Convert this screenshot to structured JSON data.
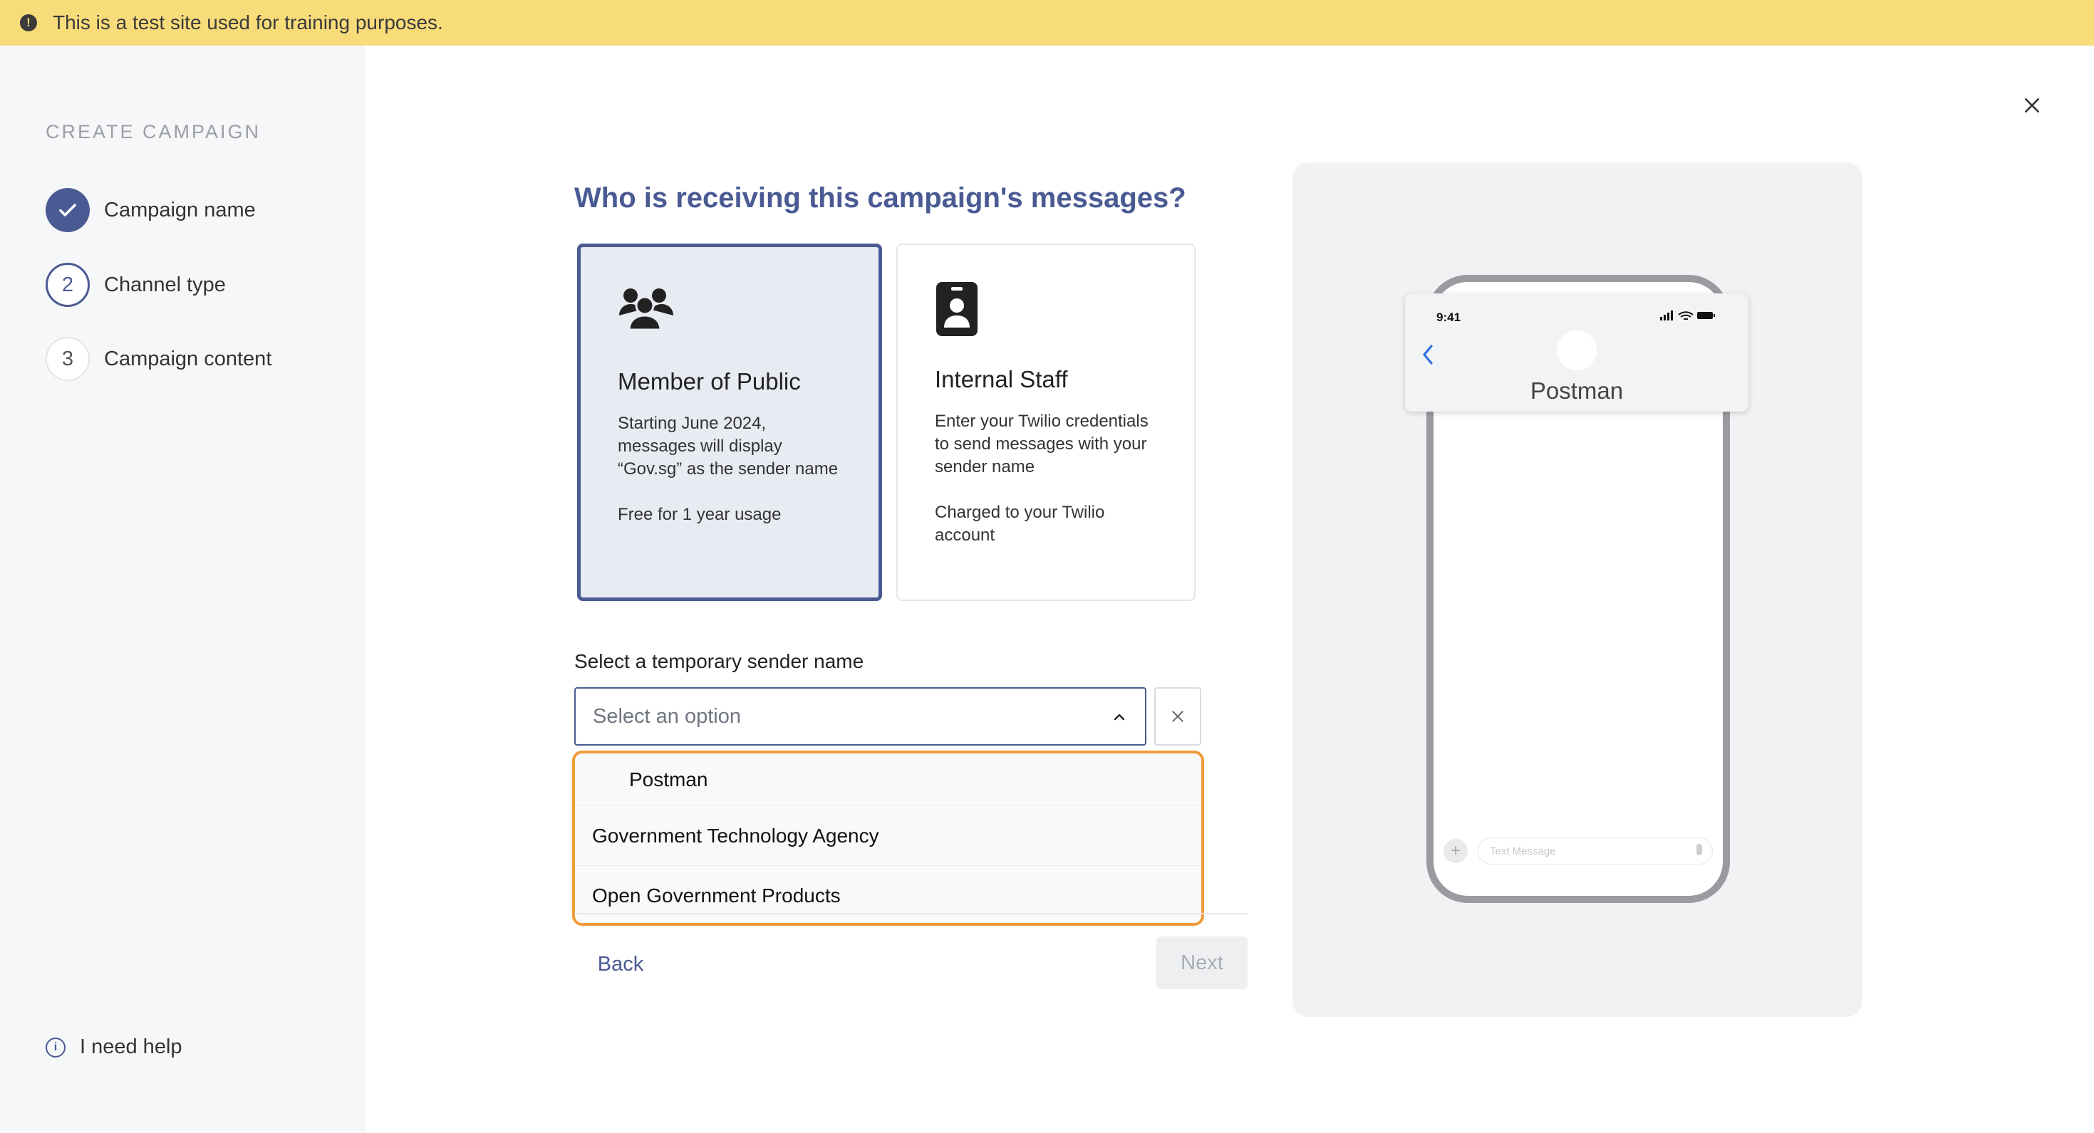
{
  "banner": {
    "text": "This is a test site used for training purposes.",
    "icon": "exclamation-icon"
  },
  "sidebar": {
    "title": "CREATE CAMPAIGN",
    "steps": [
      {
        "label": "Campaign name",
        "status": "done"
      },
      {
        "number": "2",
        "label": "Channel type",
        "status": "current"
      },
      {
        "number": "3",
        "label": "Campaign content",
        "status": "todo"
      }
    ],
    "help_label": "I need help"
  },
  "main": {
    "question": "Who is receiving this campaign's messages?",
    "cards": [
      {
        "title": "Member of Public",
        "description": "Starting June 2024, messages will display “Gov.sg” as the sender name",
        "note": "Free for 1 year usage",
        "icon": "people-group-icon",
        "selected": true
      },
      {
        "title": "Internal Staff",
        "description": "Enter your Twilio credentials to send messages with your sender name",
        "note": "Charged to your Twilio account",
        "icon": "id-badge-icon",
        "selected": false
      }
    ],
    "sender_label": "Select a temporary sender name",
    "select": {
      "placeholder": "Select an option"
    },
    "options": [
      "Postman",
      "Government Technology Agency",
      "Open Government Products"
    ],
    "back_label": "Back",
    "next_label": "Next"
  },
  "preview": {
    "time": "9:41",
    "status_icons": "signal-wifi-battery",
    "sender_name": "Postman",
    "input_placeholder": "Text Message"
  },
  "colors": {
    "accent": "#4a5a93",
    "banner": "#f9dc7a",
    "highlight": "#f19a38",
    "sidebar_bg": "#f6f7f8",
    "ios_blue": "#2f6fe4"
  }
}
